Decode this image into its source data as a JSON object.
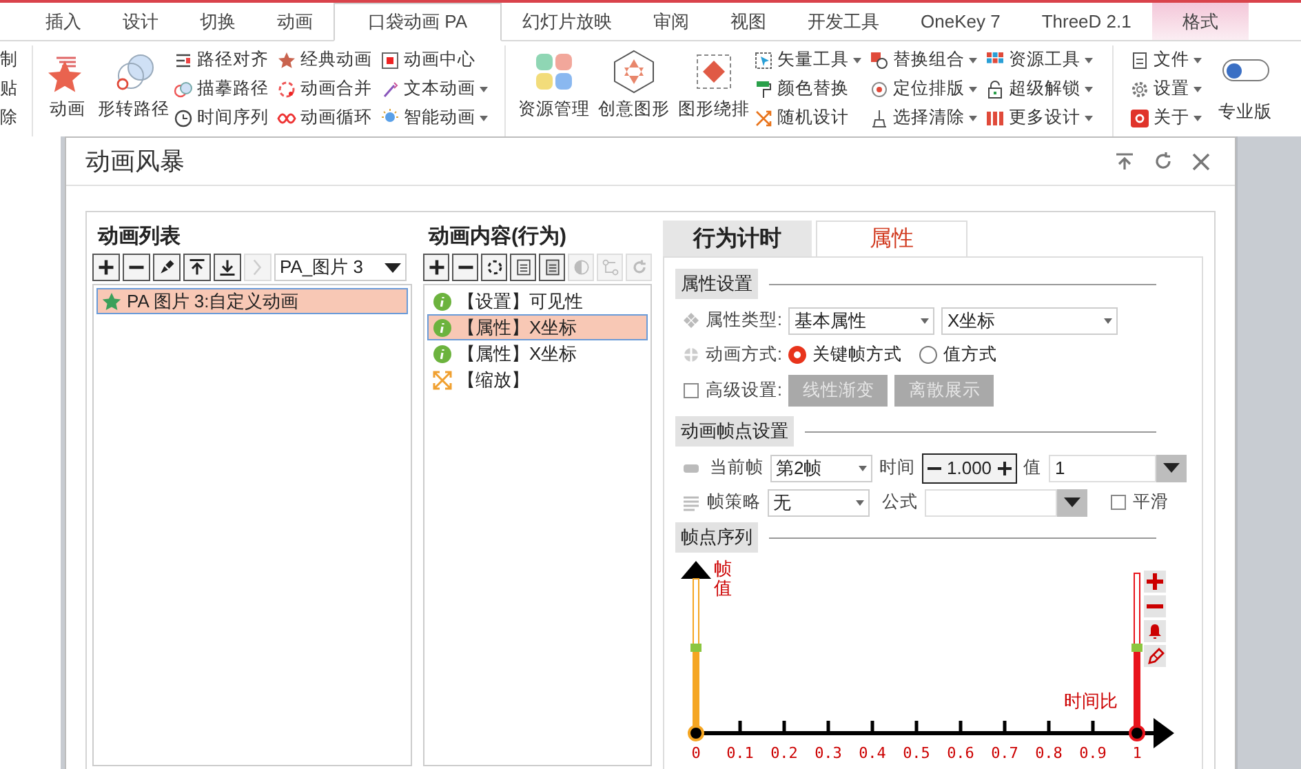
{
  "ribbon_tabs": [
    {
      "label": "插入",
      "selected": false,
      "kind": "normal"
    },
    {
      "label": "设计",
      "selected": false,
      "kind": "normal"
    },
    {
      "label": "切换",
      "selected": false,
      "kind": "normal"
    },
    {
      "label": "动画",
      "selected": false,
      "kind": "normal"
    },
    {
      "label": "口袋动画 PA",
      "selected": true,
      "kind": "normal"
    },
    {
      "label": "幻灯片放映",
      "selected": false,
      "kind": "normal"
    },
    {
      "label": "审阅",
      "selected": false,
      "kind": "normal"
    },
    {
      "label": "视图",
      "selected": false,
      "kind": "normal"
    },
    {
      "label": "开发工具",
      "selected": false,
      "kind": "normal"
    },
    {
      "label": "OneKey 7",
      "selected": false,
      "kind": "normal"
    },
    {
      "label": "ThreeD 2.1",
      "selected": false,
      "kind": "normal"
    },
    {
      "label": "格式",
      "selected": false,
      "kind": "contextual"
    }
  ],
  "ribbon": {
    "clipboard_items": [
      "制",
      "贴",
      "除"
    ],
    "large_buttons": [
      {
        "label": "动画"
      },
      {
        "label": "形转路径"
      }
    ],
    "small_columns": [
      [
        {
          "label": "路径对齐",
          "dropdown": false
        },
        {
          "label": "描摹路径",
          "dropdown": false
        },
        {
          "label": "时间序列",
          "dropdown": false
        }
      ],
      [
        {
          "label": "经典动画",
          "dropdown": false
        },
        {
          "label": "动画合并",
          "dropdown": false
        },
        {
          "label": "动画循环",
          "dropdown": false
        }
      ],
      [
        {
          "label": "动画中心",
          "dropdown": false
        },
        {
          "label": "文本动画",
          "dropdown": true
        },
        {
          "label": "智能动画",
          "dropdown": true
        }
      ]
    ],
    "large_buttons_2": [
      {
        "label": "资源管理"
      },
      {
        "label": "创意图形"
      },
      {
        "label": "图形绕排"
      }
    ],
    "small_columns_2": [
      [
        {
          "label": "矢量工具",
          "dropdown": true
        },
        {
          "label": "颜色替换",
          "dropdown": false
        },
        {
          "label": "随机设计",
          "dropdown": false
        }
      ],
      [
        {
          "label": "替换组合",
          "dropdown": true
        },
        {
          "label": "定位排版",
          "dropdown": true
        },
        {
          "label": "选择清除",
          "dropdown": true
        }
      ],
      [
        {
          "label": "资源工具",
          "dropdown": true
        },
        {
          "label": "超级解锁",
          "dropdown": true
        },
        {
          "label": "更多设计",
          "dropdown": true
        }
      ],
      [
        {
          "label": "文件",
          "dropdown": true
        },
        {
          "label": "设置",
          "dropdown": true
        },
        {
          "label": "关于",
          "dropdown": true
        }
      ]
    ],
    "pro_toggle": {
      "label": "专业版",
      "on": false
    }
  },
  "dialog": {
    "title": "动画风暴",
    "animation_list": {
      "heading": "动画列表",
      "selector": "PA_图片 3",
      "toolbar": [
        {
          "disabled": false
        },
        {
          "disabled": false
        },
        {
          "disabled": false
        },
        {
          "disabled": false
        },
        {
          "disabled": false
        },
        {
          "disabled": true
        }
      ],
      "items": [
        {
          "label": "PA 图片 3:自定义动画",
          "selected": true
        }
      ]
    },
    "animation_content": {
      "heading": "动画内容(行为)",
      "toolbar": [
        {
          "disabled": false
        },
        {
          "disabled": false
        },
        {
          "disabled": false
        },
        {
          "disabled": false
        },
        {
          "disabled": false
        },
        {
          "disabled": true
        },
        {
          "disabled": true
        },
        {
          "disabled": true
        }
      ],
      "items": [
        {
          "label": "【设置】可见性",
          "kind": "info",
          "selected": false
        },
        {
          "label": "【属性】X坐标",
          "kind": "info",
          "selected": true
        },
        {
          "label": "【属性】X坐标",
          "kind": "info",
          "selected": false
        },
        {
          "label": "【缩放】",
          "kind": "scale",
          "selected": false
        }
      ]
    },
    "panel_tabs": [
      {
        "label": "行为计时",
        "selected": false
      },
      {
        "label": "属性",
        "selected": true
      }
    ],
    "property_settings": {
      "heading": "属性设置",
      "type_label": "属性类型:",
      "type_value": "基本属性",
      "property_value": "X坐标",
      "mode_label": "动画方式:",
      "modes": [
        {
          "label": "关键帧方式",
          "selected": true
        },
        {
          "label": "值方式",
          "selected": false
        }
      ],
      "advanced_label": "高级设置:",
      "advanced_checked": false,
      "advanced_buttons": [
        {
          "label": "线性渐变",
          "disabled": true
        },
        {
          "label": "离散展示",
          "disabled": true
        }
      ]
    },
    "keyframe_settings": {
      "heading": "动画帧点设置",
      "current_label": "当前帧",
      "current_value": "第2帧",
      "time_label": "时间",
      "time_value": "1.000",
      "value_label": "值",
      "value_value": "1",
      "strategy_label": "帧策略",
      "strategy_value": "无",
      "formula_label": "公式",
      "smooth": {
        "label": "平滑",
        "checked": false
      }
    },
    "keyframe_sequence": {
      "heading": "帧点序列",
      "y_label": "帧值",
      "x_label": "时间比",
      "ticks": [
        "0",
        "0.1",
        "0.2",
        "0.3",
        "0.4",
        "0.5",
        "0.6",
        "0.7",
        "0.8",
        "0.9",
        "1"
      ],
      "keyframes": [
        {
          "color": "#f5a623"
        },
        {
          "color": "#e8141c"
        }
      ]
    }
  }
}
